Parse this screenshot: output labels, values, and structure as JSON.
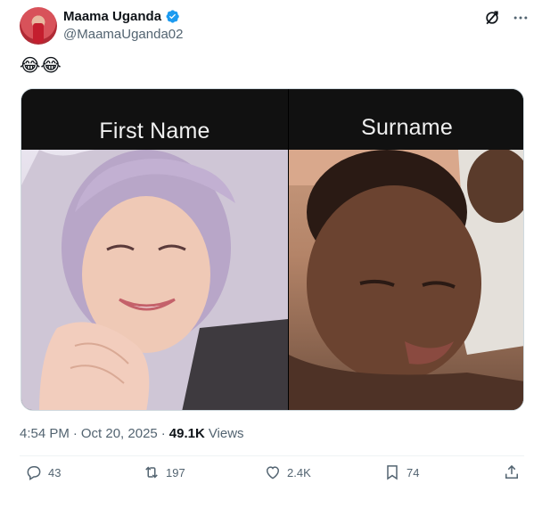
{
  "author": {
    "display_name": "Maama Uganda",
    "handle": "@MaamaUganda02",
    "verified": true
  },
  "tweet": {
    "text": "😂😂"
  },
  "media": {
    "left_caption": "First Name",
    "right_caption": "Surname"
  },
  "meta": {
    "time": "4:54 PM",
    "separator": "·",
    "date": "Oct 20, 2025",
    "views_count": "49.1K",
    "views_label": "Views"
  },
  "actions": {
    "replies": "43",
    "reposts": "197",
    "likes": "2.4K",
    "bookmarks": "74"
  },
  "colors": {
    "verified_blue": "#1d9bf0",
    "secondary_text": "#536471"
  }
}
